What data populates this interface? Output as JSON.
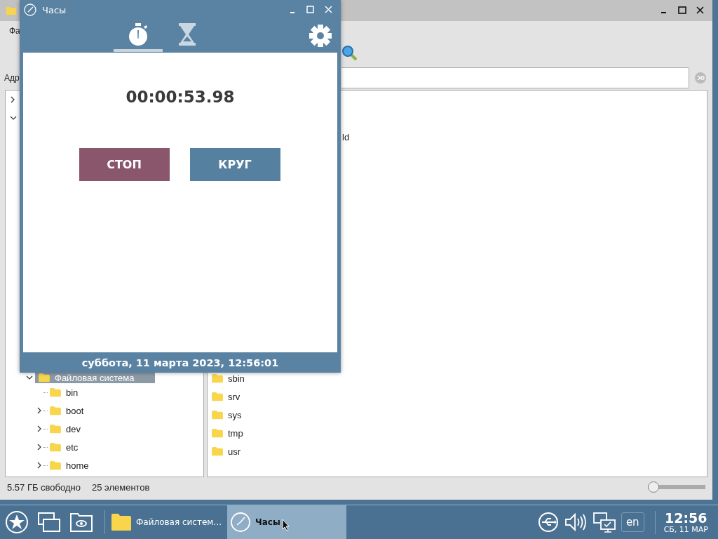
{
  "file_manager": {
    "menu": [
      "Фа"
    ],
    "address_label": "Адр",
    "tree": [
      {
        "label": "Файловая система",
        "selected": true,
        "expanded": true,
        "children": [
          {
            "label": "bin",
            "has_children": false
          },
          {
            "label": "boot",
            "has_children": true
          },
          {
            "label": "dev",
            "has_children": true
          },
          {
            "label": "etc",
            "has_children": true
          },
          {
            "label": "home",
            "has_children": true
          }
        ]
      }
    ],
    "files": [
      {
        "label": "ld",
        "kind": "cut"
      },
      {
        "label": "sbin",
        "kind": "folder"
      },
      {
        "label": "srv",
        "kind": "folder"
      },
      {
        "label": "sys",
        "kind": "folder"
      },
      {
        "label": "tmp",
        "kind": "folder"
      },
      {
        "label": "usr",
        "kind": "folder"
      }
    ],
    "status_bar": [
      "5.57 ГБ свободно",
      "25 элементов"
    ],
    "zoom_slider": {
      "level": 0
    }
  },
  "clock": {
    "title": "Часы",
    "tabs": [
      {
        "kind": "stopwatch",
        "selected": true
      },
      {
        "kind": "timer",
        "selected": false
      }
    ],
    "time": "00:00:53.98",
    "buttons": [
      {
        "label": "СТОП",
        "kind": "stop"
      },
      {
        "label": "КРУГ",
        "kind": "lap"
      }
    ],
    "date": "суббота, 11 марта 2023, 12:56:01"
  },
  "taskbar": {
    "tasks": [
      {
        "label": "Файловая систем…",
        "kind": "files",
        "selected": false
      },
      {
        "label": "Часы",
        "kind": "clock",
        "selected": true
      }
    ],
    "language": "en",
    "time": "12:56",
    "date": "СБ, 11 МАР"
  }
}
